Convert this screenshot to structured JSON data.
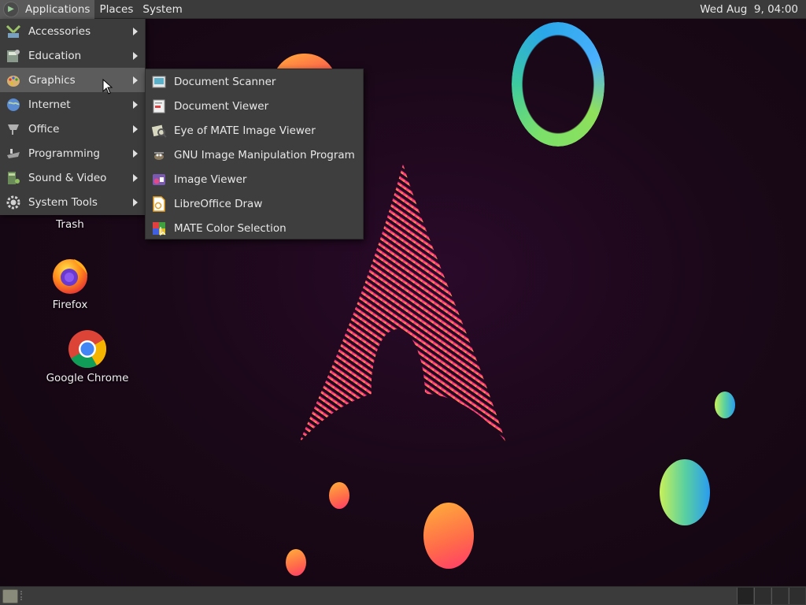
{
  "top_panel": {
    "menus": [
      "Applications",
      "Places",
      "System"
    ],
    "clock": "Wed Aug  9, 04:00"
  },
  "applications_menu": {
    "items": [
      {
        "label": "Accessories",
        "icon": "accessories-icon"
      },
      {
        "label": "Education",
        "icon": "education-icon"
      },
      {
        "label": "Graphics",
        "icon": "graphics-icon",
        "highlighted": true
      },
      {
        "label": "Internet",
        "icon": "internet-icon"
      },
      {
        "label": "Office",
        "icon": "office-icon"
      },
      {
        "label": "Programming",
        "icon": "programming-icon"
      },
      {
        "label": "Sound & Video",
        "icon": "sound-video-icon"
      },
      {
        "label": "System Tools",
        "icon": "system-tools-icon"
      }
    ]
  },
  "graphics_submenu": {
    "items": [
      {
        "label": "Document Scanner",
        "icon": "scanner-icon"
      },
      {
        "label": "Document Viewer",
        "icon": "document-viewer-icon"
      },
      {
        "label": "Eye of MATE Image Viewer",
        "icon": "eye-of-mate-icon"
      },
      {
        "label": "GNU Image Manipulation Program",
        "icon": "gimp-icon"
      },
      {
        "label": "Image Viewer",
        "icon": "image-viewer-icon"
      },
      {
        "label": "LibreOffice Draw",
        "icon": "libreoffice-draw-icon"
      },
      {
        "label": "MATE Color Selection",
        "icon": "color-selection-icon"
      }
    ]
  },
  "desktop_icons": [
    {
      "label": "Trash",
      "icon": "trash-icon"
    },
    {
      "label": "Firefox",
      "icon": "firefox-icon"
    },
    {
      "label": "Google Chrome",
      "icon": "chrome-icon"
    }
  ],
  "colors": {
    "panel": "#3b3b3b",
    "menu_bg": "#3c3c3c",
    "highlight": "#5c5c5c",
    "desktop": "#1a0818",
    "arch_pink": "#ff2d8a",
    "arch_yellow": "#ffc83a"
  }
}
